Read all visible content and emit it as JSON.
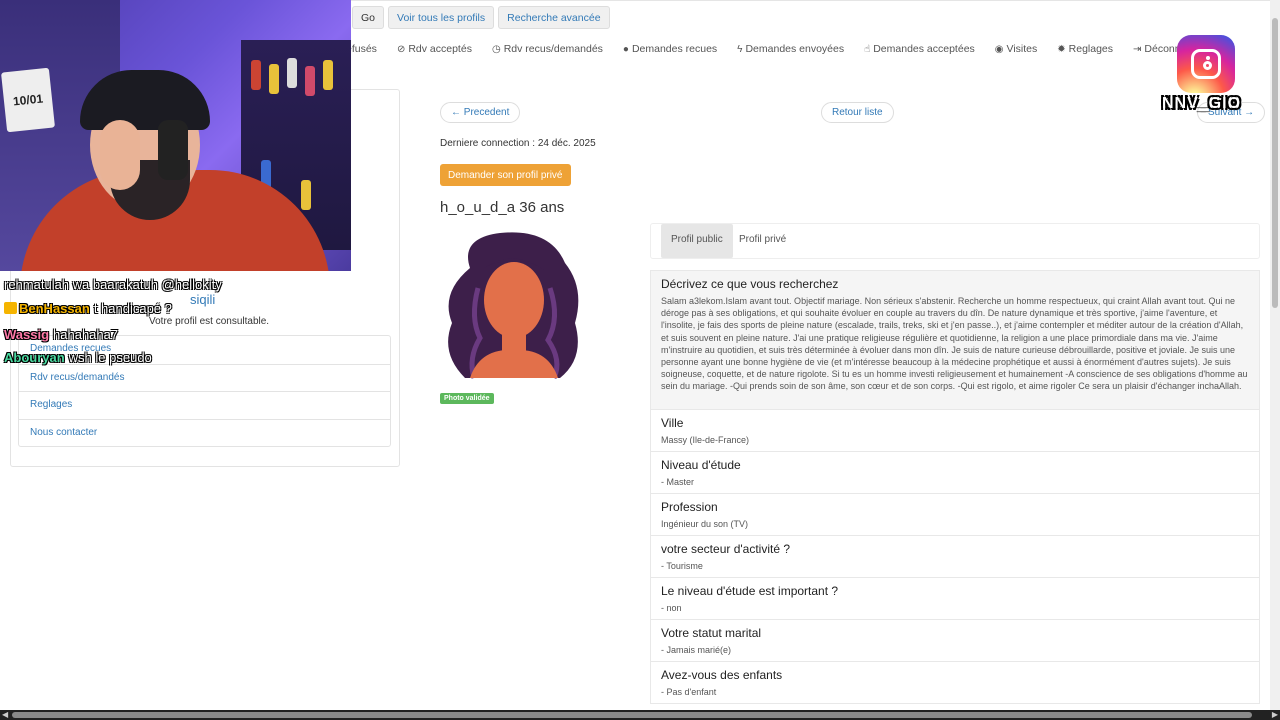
{
  "topbar": {
    "go_label": "Go",
    "all_profiles_label": "Voir tous les profils",
    "advanced_search_label": "Recherche avancée"
  },
  "nav": {
    "items": [
      {
        "label": "efusés",
        "icon": "none"
      },
      {
        "label": "Rdv acceptés",
        "icon": "check-circle-icon"
      },
      {
        "label": "Rdv recus/demandés",
        "icon": "clock-icon"
      },
      {
        "label": "Demandes recues",
        "icon": "exclamation-circle-icon"
      },
      {
        "label": "Demandes envoyées",
        "icon": "bolt-icon"
      },
      {
        "label": "Demandes acceptées",
        "icon": "thumbs-up-icon"
      },
      {
        "label": "Visites",
        "icon": "eye-icon"
      },
      {
        "label": "Reglages",
        "icon": "gear-icon"
      },
      {
        "label": "Déconnexion",
        "icon": "logout-icon"
      }
    ]
  },
  "webcam": {
    "sign_text": "10/01"
  },
  "chat": {
    "lines": [
      {
        "user": "",
        "text": "rehmatulah wa baarakatuh @hellokity"
      },
      {
        "user": "BenHassan",
        "text": "t handicapé ?"
      },
      {
        "user": "Wassig",
        "text": "hahahaha7"
      },
      {
        "user": "Abouryan",
        "text": "wsh le pseudo"
      }
    ]
  },
  "sidebar": {
    "title": "siqili",
    "status_message": "Votre profil est consultable.",
    "items": [
      {
        "label": "Demandes recues"
      },
      {
        "label": "Rdv recus/demandés"
      },
      {
        "label": "Reglages"
      },
      {
        "label": "Nous contacter"
      }
    ]
  },
  "main": {
    "prev_label": "← Precedent",
    "back_label": "Retour liste",
    "next_label": "Suivant →",
    "last_connection": "Derniere connection : 24 déc. 2025",
    "request_private_label": "Demander son profil privé",
    "profile_name": "h_o_u_d_a 36 ans",
    "photo_badge": "Photo validée"
  },
  "tabs": {
    "public": "Profil public",
    "private": "Profil privé"
  },
  "cards": {
    "search": {
      "title": "Décrivez ce que vous recherchez",
      "text": "Salam a3lekom.Islam avant tout. Objectif mariage. Non sérieux s'abstenir. Recherche un homme respectueux, qui craint Allah avant tout. Qui ne déroge pas à ses obligations, et qui souhaite évoluer en couple au travers du dîn. De nature dynamique et très sportive, j'aime l'aventure, et l'insolite, je fais des sports de pleine nature (escalade, trails, treks, ski et j'en passe..), et j'aime contempler et méditer autour de la création d'Allah, et suis souvent en pleine nature. J'ai une pratique religieuse régulière et quotidienne, la religion a une place primordiale dans ma vie. J'aime m'instruire au quotidien, et suis très déterminée à évoluer dans mon dîn. Je suis de nature curieuse débrouillarde, positive et joviale. Je suis une personne ayant une bonne hygiène de vie (et m'intéresse beaucoup à la médecine prophétique et aussi à énormément d'autres sujets). Je suis soigneuse, coquette, et de nature rigolote. Si tu es un homme investi religieusement et humainement -A conscience de ses obligations d'homme au sein du mariage. -Qui prends soin de son âme, son cœur et de son corps. -Qui est rigolo, et aime rigoler Ce sera un plaisir d'échanger inchaAllah."
    },
    "ville": {
      "title": "Ville",
      "value": "Massy (Ile-de-France)"
    },
    "niveau": {
      "title": "Niveau d'étude",
      "value": "- Master"
    },
    "profession": {
      "title": "Profession",
      "value": "Ingénieur du son (TV)"
    },
    "secteur": {
      "title": "votre secteur d'activité ?",
      "value": "- Tourisme"
    },
    "niveau_important": {
      "title": "Le niveau d'étude est important ?",
      "value": "- non"
    },
    "statut": {
      "title": "Votre statut marital",
      "value": "- Jamais marié(e)"
    },
    "enfants": {
      "title": "Avez-vous des enfants",
      "value": "- Pas d'enfant"
    }
  },
  "overlay": {
    "handle": "NNV_GIO"
  },
  "colors": {
    "link": "#337ab7",
    "request_button": "#eea236",
    "photo_badge": "#5cb85c"
  }
}
